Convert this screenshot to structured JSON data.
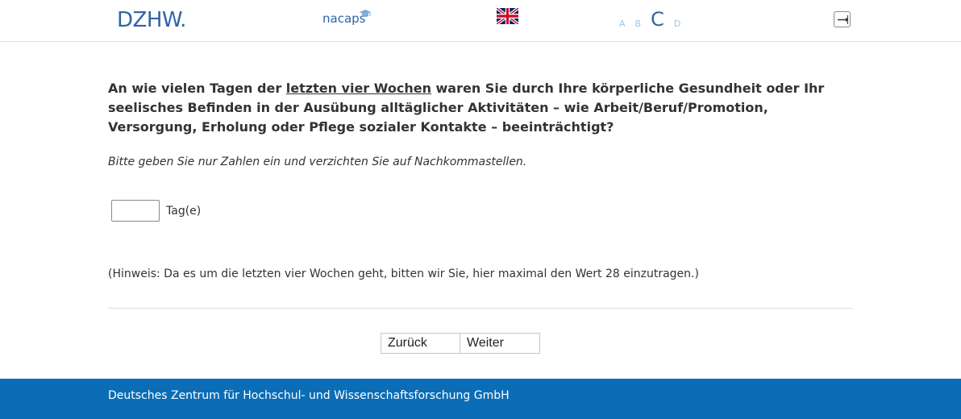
{
  "header": {
    "logo_text": "DZHW.",
    "partner_logo_text": "nacaps",
    "language_flag": "uk-flag-icon",
    "font_size_options": [
      "A",
      "B",
      "C",
      "D"
    ],
    "font_size_selected": "C",
    "logout_icon": "logout-arrow-icon"
  },
  "question": {
    "text_before": "An wie vielen Tagen der ",
    "text_underlined": "letzten vier Wochen",
    "text_after": " waren Sie durch Ihre körperliche Gesundheit oder Ihr seelisches Befinden in der Ausübung alltäglicher Aktivitäten – wie Arbeit/Beruf/Promotion, Versorgung, Erholung oder Pflege sozialer Kontakte – beeinträchtigt?",
    "instruction": "Bitte geben Sie nur Zahlen ein und verzichten Sie auf Nachkommastellen.",
    "answer_value": "",
    "unit_label": "Tag(e)",
    "hint": "(Hinweis: Da es um die letzten vier Wochen geht, bitten wir Sie, hier maximal den Wert 28 einzutragen.)"
  },
  "navigation": {
    "back_label": "Zurück",
    "next_label": "Weiter"
  },
  "footer": {
    "text": "Deutsches Zentrum für Hochschul- und Wissenschaftsforschung GmbH"
  },
  "colors": {
    "brand_blue": "#2f64a4",
    "footer_blue": "#0b6db6",
    "font_size_inactive": "#9cc3e6"
  }
}
